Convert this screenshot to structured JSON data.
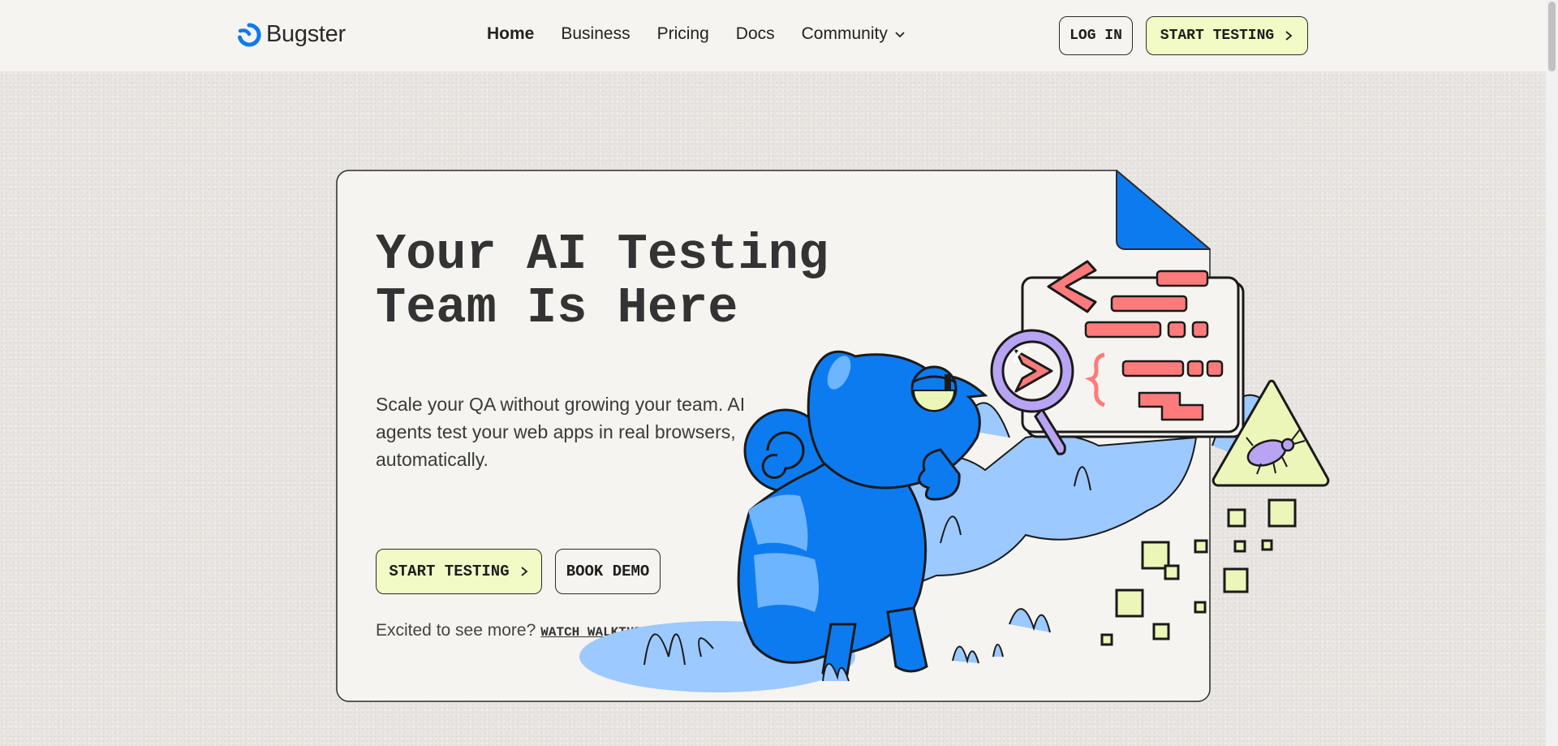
{
  "brand": {
    "name": "Bugster"
  },
  "nav": {
    "items": [
      {
        "label": "Home",
        "active": true
      },
      {
        "label": "Business"
      },
      {
        "label": "Pricing"
      },
      {
        "label": "Docs"
      },
      {
        "label": "Community",
        "has_dropdown": true
      }
    ]
  },
  "header": {
    "login_label": "LOG IN",
    "start_label": "START TESTING"
  },
  "hero": {
    "title_line1": "Your AI Testing",
    "title_line2": "Team Is Here",
    "subtitle": "Scale your QA without growing your team. AI agents test your web apps in real browsers, automatically.",
    "start_label": "START TESTING",
    "demo_label": "BOOK DEMO",
    "watch_prompt": "Excited to see more?",
    "watch_label": "WATCH WALKTHROUGH"
  },
  "colors": {
    "accent_blue": "#0d7bf0",
    "light_blue": "#9cc9ff",
    "cta_lime": "#f2fbc5",
    "code_red": "#ff7b7b",
    "lens_purple": "#b8a4f2",
    "warning_yellow": "#ecf6b8"
  },
  "icons": [
    "bugster-logo-icon",
    "chevron-down-icon",
    "chevron-right-icon",
    "chameleon-illustration",
    "magnifier-icon",
    "bug-warning-icon",
    "code-window-icon"
  ]
}
